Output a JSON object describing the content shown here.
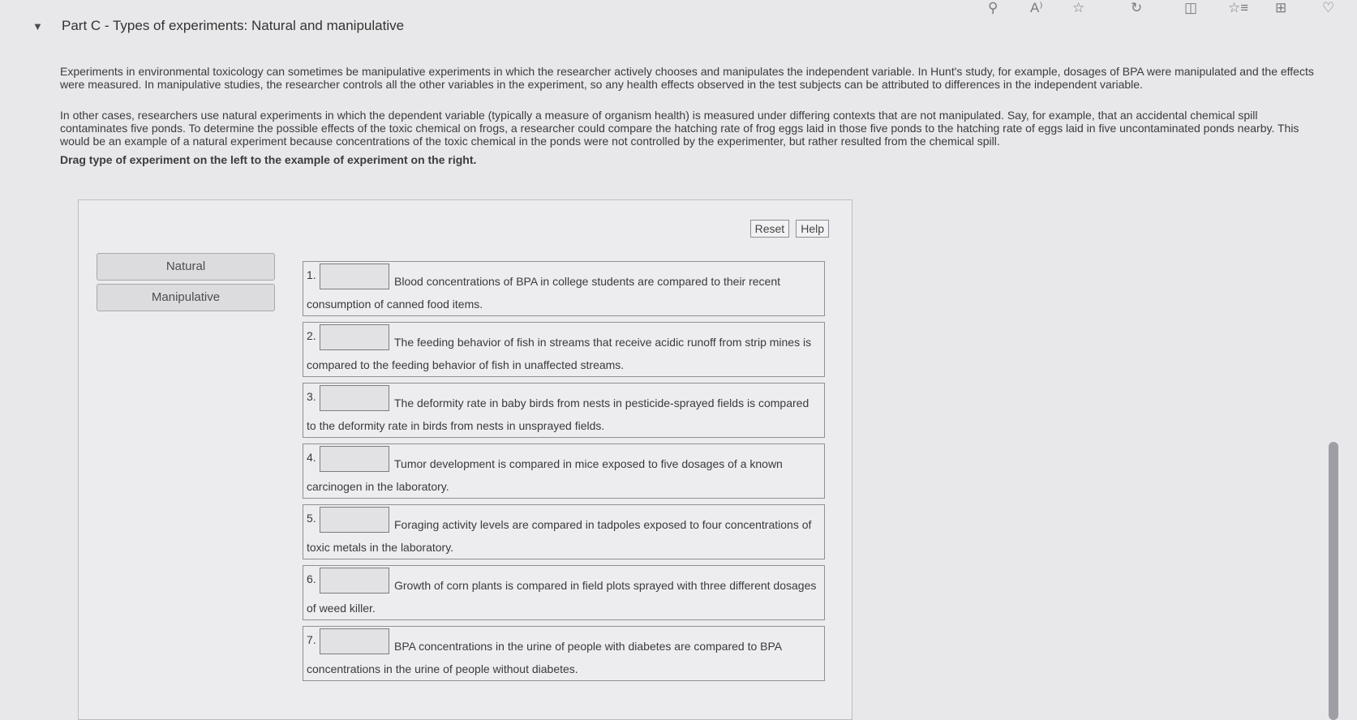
{
  "toolbar": {
    "icons": [
      {
        "name": "search-icon",
        "glyph": "⚲"
      },
      {
        "name": "read-aloud-icon",
        "glyph": "A⁾"
      },
      {
        "name": "favorite-star-icon",
        "glyph": "☆"
      },
      {
        "name": "refresh-icon",
        "glyph": "↻"
      },
      {
        "name": "split-screen-icon",
        "glyph": "◫"
      },
      {
        "name": "favorites-list-icon",
        "glyph": "☆≡"
      },
      {
        "name": "collections-icon",
        "glyph": "⊞"
      },
      {
        "name": "extensions-icon",
        "glyph": "♡"
      }
    ]
  },
  "section": {
    "caret": "▼",
    "title": "Part C - Types of experiments: Natural and manipulative"
  },
  "intro": {
    "paragraph1": "Experiments in environmental toxicology can sometimes be manipulative experiments in which the researcher actively chooses and manipulates the independent variable. In Hunt's study, for example, dosages of BPA were manipulated and the effects were measured. In manipulative studies, the researcher controls all the other variables in the experiment, so any health effects observed in the test subjects can be attributed to differences in the independent variable.",
    "paragraph2": "In other cases, researchers use natural experiments in which the dependent variable (typically a measure of organism health) is measured under differing contexts that are not manipulated. Say, for example, that an accidental chemical spill contaminates five ponds. To determine the possible effects of the toxic chemical on frogs, a researcher could compare the hatching rate of frog eggs laid in those five ponds to the hatching rate of eggs laid in five uncontaminated ponds nearby. This would be an example of a natural experiment because concentrations of the toxic chemical in the ponds were not controlled by the experimenter, but rather resulted from the chemical spill.",
    "instruction": "Drag type of experiment on the left to the example of experiment on the right."
  },
  "buttons": {
    "reset": "Reset",
    "help": "Help"
  },
  "chips": [
    "Natural",
    "Manipulative"
  ],
  "items": [
    {
      "num": "1.",
      "text": "Blood concentrations of BPA in college students are compared to their recent consumption of canned food items."
    },
    {
      "num": "2.",
      "text": "The feeding behavior of fish in streams that receive acidic runoff from strip mines is compared to the feeding behavior of fish in unaffected streams."
    },
    {
      "num": "3.",
      "text": "The deformity rate in baby birds from nests in pesticide-sprayed fields is compared to the deformity rate in birds from nests in unsprayed fields."
    },
    {
      "num": "4.",
      "text": "Tumor development is compared in mice exposed to five dosages of a known carcinogen in the laboratory."
    },
    {
      "num": "5.",
      "text": "Foraging activity levels are compared in tadpoles exposed to four concentrations of toxic metals in the laboratory."
    },
    {
      "num": "6.",
      "text": "Growth of corn plants is compared in field plots sprayed with three different dosages of weed killer."
    },
    {
      "num": "7.",
      "text": "BPA concentrations in the urine of people with diabetes are compared to BPA concentrations in the urine of people without diabetes."
    }
  ]
}
